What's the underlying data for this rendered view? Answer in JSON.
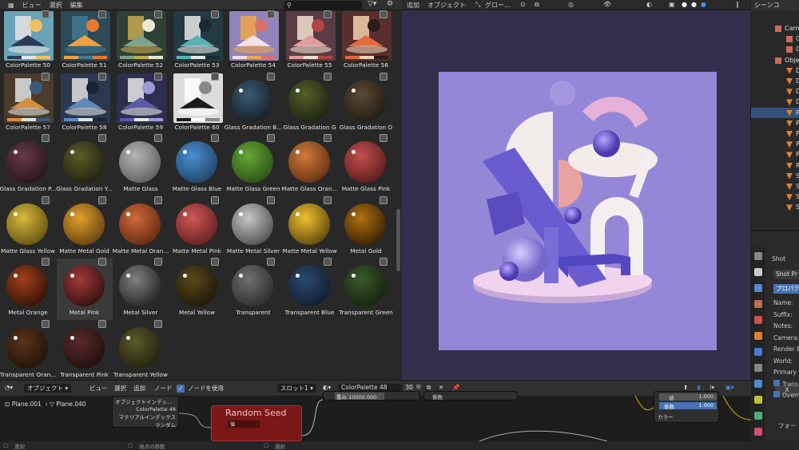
{
  "asset_browser": {
    "menu": [
      "ビュー",
      "選択",
      "編集"
    ],
    "search_placeholder": "",
    "assets": [
      {
        "name": "ColorPalette 50",
        "kind": "palette",
        "bg": "#6aa3b8",
        "colors": [
          "#2a3a58",
          "#e4e4e4",
          "#f0c060"
        ]
      },
      {
        "name": "ColorPalette 51",
        "kind": "palette",
        "bg": "#2c4a58",
        "colors": [
          "#f0a040",
          "#3f7a90",
          "#e87b2b"
        ]
      },
      {
        "name": "ColorPalette 52",
        "kind": "palette",
        "bg": "#2f4037",
        "colors": [
          "#7fa38a",
          "#c6a84e",
          "#e9e9d2"
        ]
      },
      {
        "name": "ColorPalette 53",
        "kind": "palette",
        "bg": "#223a42",
        "colors": [
          "#59b2b2",
          "#e8e8e8",
          "#1a2a30"
        ]
      },
      {
        "name": "ColorPalette 54",
        "kind": "palette",
        "bg": "#9184b8",
        "colors": [
          "#f3dfe6",
          "#f0a44a",
          "#d97070"
        ]
      },
      {
        "name": "ColorPalette 55",
        "kind": "palette",
        "bg": "#5a3c44",
        "colors": [
          "#e39c9c",
          "#f0e0d0",
          "#b34444"
        ]
      },
      {
        "name": "ColorPalette 56",
        "kind": "palette",
        "bg": "#5a2e2e",
        "colors": [
          "#e56a3a",
          "#f0d0b0",
          "#2d1a1a"
        ]
      },
      {
        "name": "ColorPalette 57",
        "kind": "palette",
        "bg": "#4a3c2c",
        "colors": [
          "#d38e3e",
          "#e0e0e0",
          "#3a5a78"
        ]
      },
      {
        "name": "ColorPalette 58",
        "kind": "palette",
        "bg": "#2a3850",
        "colors": [
          "#5e8ab8",
          "#e0e0e0",
          "#1a2436"
        ]
      },
      {
        "name": "ColorPalette 59",
        "kind": "palette",
        "bg": "#2e2e52",
        "colors": [
          "#5a5aa8",
          "#e6e6e6",
          "#9a9ad4"
        ]
      },
      {
        "name": "ColorPalette 60",
        "kind": "palette",
        "bg": "#dcdcdc",
        "colors": [
          "#1a1a1a",
          "#ffffff",
          "#888888"
        ]
      },
      {
        "name": "Glass Gradation B...",
        "kind": "sphere",
        "c1": "#3b5b75",
        "c2": "#0d1014"
      },
      {
        "name": "Glass Gradation G",
        "kind": "sphere",
        "c1": "#54602c",
        "c2": "#101408"
      },
      {
        "name": "Glass Gradation O",
        "kind": "sphere",
        "c1": "#5c4a34",
        "c2": "#14100a"
      },
      {
        "name": "Glass Gradation P...",
        "kind": "sphere",
        "c1": "#6a3a48",
        "c2": "#160c10"
      },
      {
        "name": "Glass Gradation Y...",
        "kind": "sphere",
        "c1": "#5c5c28",
        "c2": "#141408"
      },
      {
        "name": "Matte Glass",
        "kind": "sphere",
        "c1": "#b5b5b5",
        "c2": "#4a4a4a"
      },
      {
        "name": "Matte Glass Blue",
        "kind": "sphere",
        "c1": "#4a8fd0",
        "c2": "#15334e"
      },
      {
        "name": "Matte Glass Green",
        "kind": "sphere",
        "c1": "#66a837",
        "c2": "#1d3a0c"
      },
      {
        "name": "Matte Glass Oran...",
        "kind": "sphere",
        "c1": "#d07a3a",
        "c2": "#4a200a"
      },
      {
        "name": "Matte Glass Pink",
        "kind": "sphere",
        "c1": "#c45050",
        "c2": "#421010"
      },
      {
        "name": "Matte Glass Yellow",
        "kind": "sphere",
        "c1": "#d8b83a",
        "c2": "#4a3a08"
      },
      {
        "name": "Matte Metal Gold",
        "kind": "sphere",
        "c1": "#e0a030",
        "c2": "#4a2a04"
      },
      {
        "name": "Matte Metal Oran...",
        "kind": "sphere",
        "c1": "#d06a3a",
        "c2": "#4a1a08"
      },
      {
        "name": "Matte Metal Pink",
        "kind": "sphere",
        "c1": "#d05858",
        "c2": "#481212"
      },
      {
        "name": "Matte Metal Silver",
        "kind": "sphere",
        "c1": "#c8c8c8",
        "c2": "#333333"
      },
      {
        "name": "Matte Metal Yellow",
        "kind": "sphere",
        "c1": "#f0c030",
        "c2": "#3a2a04"
      },
      {
        "name": "Metal Gold",
        "kind": "sphere",
        "c1": "#b07010",
        "c2": "#1a0e02"
      },
      {
        "name": "Metal Orange",
        "kind": "sphere",
        "c1": "#a0401a",
        "c2": "#1a0804"
      },
      {
        "name": "Metal Pink",
        "kind": "sphere",
        "c1": "#a03a3a",
        "c2": "#1a0606"
      },
      {
        "name": "Metal Silver",
        "kind": "sphere",
        "c1": "#808080",
        "c2": "#101010"
      },
      {
        "name": "Metal Yellow",
        "kind": "sphere",
        "c1": "#5a4a1a",
        "c2": "#0e0c04"
      },
      {
        "name": "Transparent",
        "kind": "sphere",
        "c1": "#707070",
        "c2": "#1e1e1e"
      },
      {
        "name": "Transparent Blue",
        "kind": "sphere",
        "c1": "#2a4a70",
        "c2": "#0a1420"
      },
      {
        "name": "Transparent Green",
        "kind": "sphere",
        "c1": "#3a5a2a",
        "c2": "#0c160a"
      },
      {
        "name": "Transparent Oran...",
        "kind": "sphere",
        "c1": "#5a3418",
        "c2": "#140a04"
      },
      {
        "name": "Transparent Pink",
        "kind": "sphere",
        "c1": "#5a2a2a",
        "c2": "#140808"
      },
      {
        "name": "Transparent Yellow",
        "kind": "sphere",
        "c1": "#5a5a2a",
        "c2": "#141408"
      }
    ]
  },
  "viewport": {
    "menu": [
      "追加",
      "オブジェクト",
      "グロー..."
    ]
  },
  "outliner": {
    "title": "シーンコ",
    "rows": [
      {
        "label": "Came",
        "icon": "camera-collection-icon",
        "level": 1,
        "selected": false
      },
      {
        "label": "C",
        "icon": "camera-icon",
        "level": 2,
        "selected": false
      },
      {
        "label": "C",
        "icon": "camera-icon",
        "level": 2,
        "selected": false
      },
      {
        "label": "Objec",
        "icon": "collection-icon",
        "level": 1,
        "selected": false
      },
      {
        "label": "D",
        "icon": "mesh-icon",
        "level": 2,
        "selected": false
      },
      {
        "label": "D",
        "icon": "mesh-icon",
        "level": 2,
        "selected": false
      },
      {
        "label": "D",
        "icon": "mesh-icon",
        "level": 2,
        "selected": false
      },
      {
        "label": "D",
        "icon": "mesh-icon",
        "level": 2,
        "selected": false
      },
      {
        "label": "P",
        "icon": "mesh-icon",
        "level": 2,
        "selected": true
      },
      {
        "label": "P",
        "icon": "mesh-icon",
        "level": 2,
        "selected": false
      },
      {
        "label": "P",
        "icon": "mesh-icon",
        "level": 2,
        "selected": false
      },
      {
        "label": "P",
        "icon": "mesh-icon",
        "level": 2,
        "selected": false
      },
      {
        "label": "P",
        "icon": "mesh-icon",
        "level": 2,
        "selected": false
      },
      {
        "label": "R",
        "icon": "mesh-icon",
        "level": 2,
        "selected": false
      },
      {
        "label": "S",
        "icon": "mesh-icon",
        "level": 2,
        "selected": false
      },
      {
        "label": "S",
        "icon": "mesh-icon",
        "level": 2,
        "selected": false
      },
      {
        "label": "S",
        "icon": "mesh-icon",
        "level": 2,
        "selected": false
      },
      {
        "label": "S",
        "icon": "mesh-icon",
        "level": 2,
        "selected": false
      }
    ]
  },
  "properties": {
    "panel_title": "Shot",
    "preset": "Shot Pr",
    "section": "プロパテ",
    "fields": [
      "Name:",
      "Suffix:",
      "Notes:",
      "Camera:",
      "Render E",
      "World:",
      "Primary L"
    ],
    "checks": [
      "Trans",
      "Overr"
    ],
    "x_button": "X",
    "footer": "フォー"
  },
  "node_editor": {
    "mode": "オブジェクト",
    "menu": [
      "ビュー",
      "選択",
      "追加",
      "ノード"
    ],
    "use_nodes_label": "ノードを使用",
    "use_nodes_checked": true,
    "slot": "スロット1",
    "material": "ColorPalette 48",
    "user_count": "30",
    "breadcrumb": [
      "Plane.001",
      "Plane.040"
    ],
    "node_obj_info": {
      "title": "オブジェクトインデッ...",
      "rows": [
        "ColorPalette 48",
        "マテリアルインデックス",
        "ランダム"
      ]
    },
    "node_random_seed": {
      "title": "Random Seed",
      "field": "値"
    },
    "node_value_top": {
      "label": "重み",
      "value": "10000.000"
    },
    "node_factor_label": "係数",
    "node_mix": {
      "rows": [
        {
          "label": "値",
          "value": "1.000"
        },
        {
          "label": "係数",
          "value": "1.000"
        }
      ],
      "out": "カラー"
    }
  },
  "status": {
    "left": "選択",
    "mid": "視点の移動",
    "right": "選択"
  }
}
